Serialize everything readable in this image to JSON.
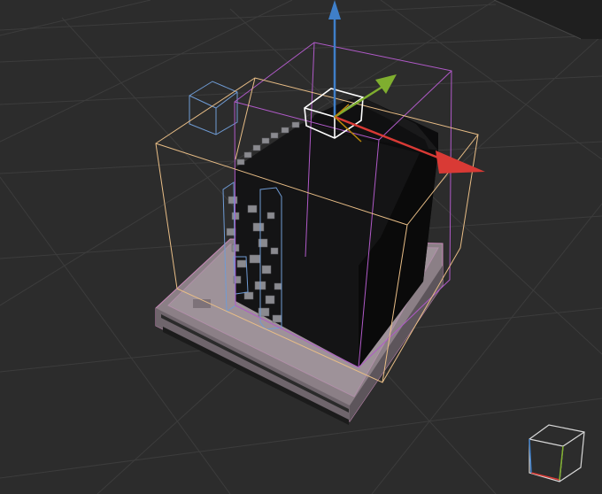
{
  "viewport": {
    "background": "#2c2c2c",
    "grid_color": "#3b3b3b",
    "horizon_color": "#202020"
  },
  "selection": {
    "outer_bounds_color": "#e8bd86",
    "inner_bounds_color": "#b05ac8",
    "child_bounds_color": "#6f9bd4",
    "active_box_color": "#ffffff"
  },
  "gizmo": {
    "x_axis_color": "#d93a35",
    "y_axis_color": "#7fae2f",
    "z_axis_color": "#3f7fc9",
    "plane_handle_color": "#b8860b"
  },
  "model": {
    "body_color": "#121213",
    "base_color": "#8c8087"
  },
  "view_cube": {
    "icon": "view-cube-icon",
    "x_color": "#d93a35",
    "y_color": "#7fae2f",
    "z_color": "#3f7fc9"
  }
}
